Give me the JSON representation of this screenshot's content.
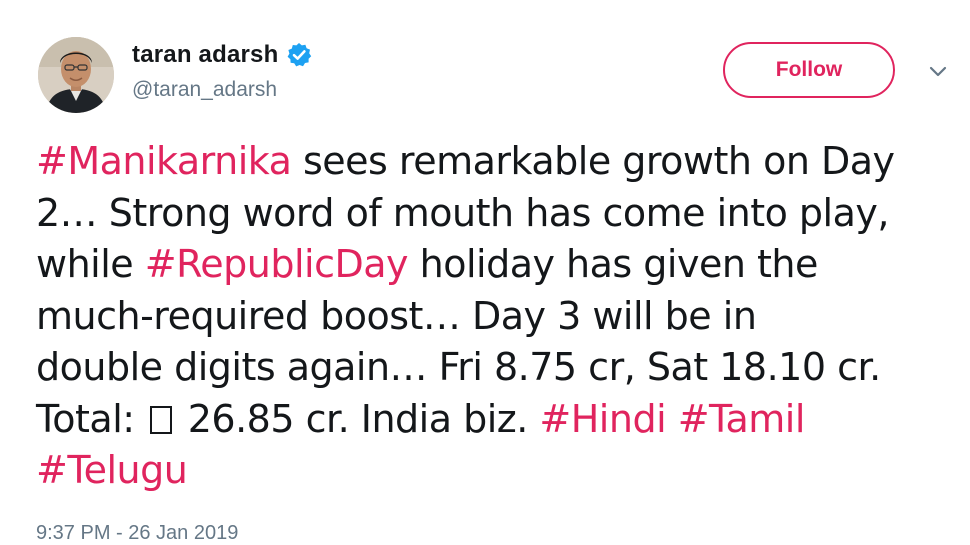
{
  "user": {
    "display_name": "taran adarsh",
    "handle": "@taran_adarsh",
    "verified": true,
    "avatar_icon": "profile-photo"
  },
  "actions": {
    "follow_label": "Follow",
    "caret_icon": "chevron-down-icon"
  },
  "tweet": {
    "lines": [
      [
        {
          "text": "#Manikarnika",
          "hashtag": true
        },
        {
          "text": " sees remarkable growth on Day",
          "hashtag": false
        }
      ],
      [
        {
          "text": "2… Strong word of mouth has come into play,",
          "hashtag": false
        }
      ],
      [
        {
          "text": "while ",
          "hashtag": false
        },
        {
          "text": "#RepublicDay",
          "hashtag": true
        },
        {
          "text": " holiday has given the",
          "hashtag": false
        }
      ],
      [
        {
          "text": "much-required boost… Day 3 will be in",
          "hashtag": false
        }
      ],
      [
        {
          "text": "double digits again… Fri 8.75 cr, Sat 18.10 cr.",
          "hashtag": false
        }
      ],
      [
        {
          "text": "Total: ",
          "hashtag": false
        },
        {
          "text": "",
          "box": true
        },
        {
          "text": " 26.85 cr. India biz. ",
          "hashtag": false
        },
        {
          "text": "#Hindi",
          "hashtag": true
        },
        {
          "text": " ",
          "hashtag": false
        },
        {
          "text": "#Tamil",
          "hashtag": true
        }
      ],
      [
        {
          "text": "#Telugu",
          "hashtag": true
        }
      ]
    ],
    "timestamp": "9:37 PM - 26 Jan 2019"
  },
  "colors": {
    "accent": "#e0245e",
    "text": "#14171a",
    "secondary": "#657786",
    "verified_blue": "#1da1f2"
  }
}
